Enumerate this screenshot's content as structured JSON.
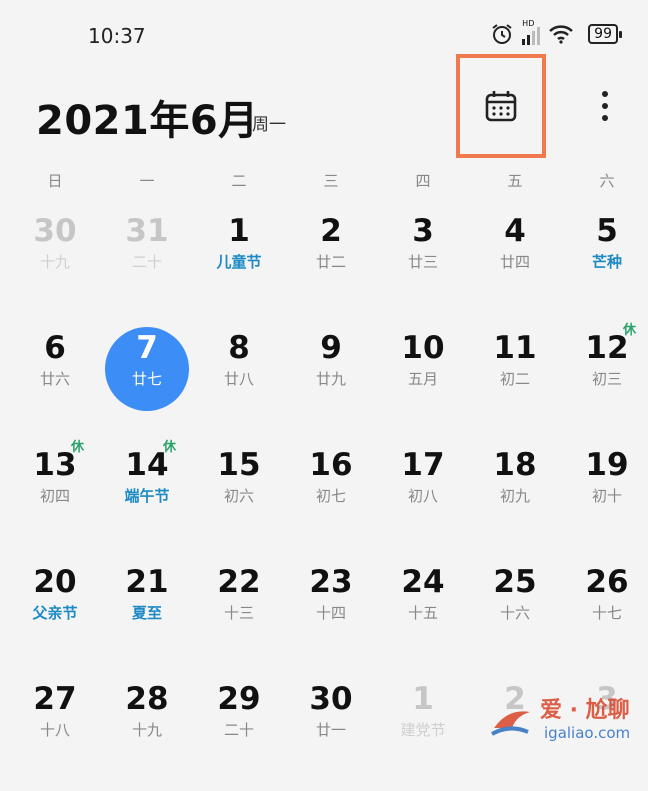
{
  "status": {
    "time": "10:37",
    "battery": "99",
    "network": "HD"
  },
  "header": {
    "month_title": "2021年6月",
    "weekday_hint": "周一"
  },
  "weekdays": [
    "日",
    "一",
    "二",
    "三",
    "四",
    "五",
    "六"
  ],
  "days": [
    {
      "num": "30",
      "sub": "十九",
      "dim": true
    },
    {
      "num": "31",
      "sub": "二十",
      "dim": true
    },
    {
      "num": "1",
      "sub": "儿童节",
      "festival": true
    },
    {
      "num": "2",
      "sub": "廿二"
    },
    {
      "num": "3",
      "sub": "廿三"
    },
    {
      "num": "4",
      "sub": "廿四"
    },
    {
      "num": "5",
      "sub": "芒种",
      "festival": true
    },
    {
      "num": "6",
      "sub": "廿六"
    },
    {
      "num": "7",
      "sub": "廿七",
      "today": true
    },
    {
      "num": "8",
      "sub": "廿八"
    },
    {
      "num": "9",
      "sub": "廿九"
    },
    {
      "num": "10",
      "sub": "五月"
    },
    {
      "num": "11",
      "sub": "初二"
    },
    {
      "num": "12",
      "sub": "初三",
      "badge": "休"
    },
    {
      "num": "13",
      "sub": "初四",
      "badge": "休"
    },
    {
      "num": "14",
      "sub": "端午节",
      "festival": true,
      "badge": "休"
    },
    {
      "num": "15",
      "sub": "初六"
    },
    {
      "num": "16",
      "sub": "初七"
    },
    {
      "num": "17",
      "sub": "初八"
    },
    {
      "num": "18",
      "sub": "初九"
    },
    {
      "num": "19",
      "sub": "初十"
    },
    {
      "num": "20",
      "sub": "父亲节",
      "festival": true
    },
    {
      "num": "21",
      "sub": "夏至",
      "festival": true
    },
    {
      "num": "22",
      "sub": "十三"
    },
    {
      "num": "23",
      "sub": "十四"
    },
    {
      "num": "24",
      "sub": "十五"
    },
    {
      "num": "25",
      "sub": "十六"
    },
    {
      "num": "26",
      "sub": "十七"
    },
    {
      "num": "27",
      "sub": "十八"
    },
    {
      "num": "28",
      "sub": "十九"
    },
    {
      "num": "29",
      "sub": "二十"
    },
    {
      "num": "30",
      "sub": "廿一"
    },
    {
      "num": "1",
      "sub": "建党节",
      "dim": true
    },
    {
      "num": "2",
      "sub": "",
      "dim": true
    },
    {
      "num": "3",
      "sub": "",
      "dim": true
    }
  ],
  "watermark": {
    "text_cn": "爱 · 尬聊",
    "url": "igaliao.com"
  },
  "colors": {
    "accent": "#3c8df5",
    "festival": "#1d8ac4",
    "highlight_box": "#f07a4d",
    "rest_badge": "#2aa36b"
  }
}
